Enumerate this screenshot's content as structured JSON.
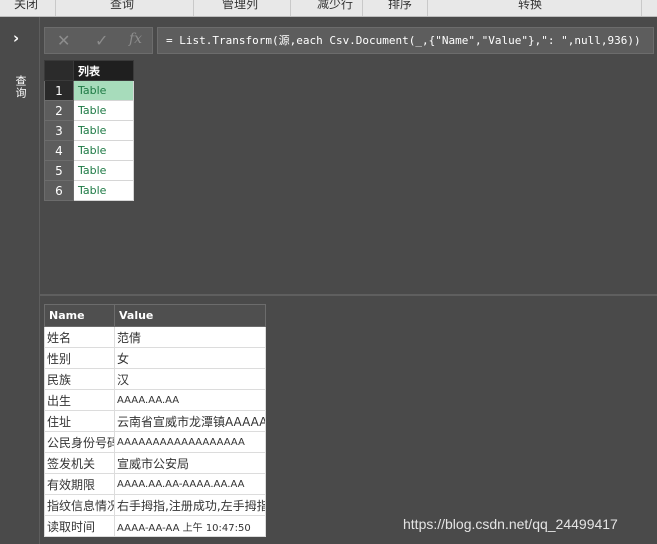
{
  "ribbon": {
    "groups": [
      "关闭",
      "查询",
      "管理列",
      "减少行",
      "排序",
      "转换"
    ]
  },
  "left_pane": {
    "chevron": "›",
    "label": "查询"
  },
  "formula_bar": {
    "cancel_icon": "✕",
    "commit_icon": "✓",
    "fx_icon": "fx",
    "expression": "= List.Transform(源,each Csv.Document(_,{\"Name\",\"Value\"},\": \",null,936))"
  },
  "list_table": {
    "header": "列表",
    "rows": [
      {
        "num": "1",
        "value": "Table"
      },
      {
        "num": "2",
        "value": "Table"
      },
      {
        "num": "3",
        "value": "Table"
      },
      {
        "num": "4",
        "value": "Table"
      },
      {
        "num": "5",
        "value": "Table"
      },
      {
        "num": "6",
        "value": "Table"
      }
    ],
    "selected_row": 1
  },
  "preview_table": {
    "columns": [
      "Name",
      "Value"
    ],
    "rows": [
      {
        "name": "姓名",
        "value": "范倩"
      },
      {
        "name": "性别",
        "value": "女"
      },
      {
        "name": "民族",
        "value": "汉"
      },
      {
        "name": "出生",
        "value": "AAAA.AA.AA"
      },
      {
        "name": "住址",
        "value": "云南省宣威市龙潭镇AAAAA/"
      },
      {
        "name": "公民身份号码",
        "value": "AAAAAAAAAAAAAAAAAA"
      },
      {
        "name": "签发机关",
        "value": "宣威市公安局"
      },
      {
        "name": "有效期限",
        "value": "AAAA.AA.AA-AAAA.AA.AA"
      },
      {
        "name": "指纹信息情况",
        "value": "右手拇指,注册成功,左手拇指"
      },
      {
        "name": "读取时间",
        "value": "AAAA-AA-AA 上午 10:47:50"
      }
    ]
  },
  "watermark": "https://blog.csdn.net/qq_24499417",
  "colors": {
    "background": "#4a4a4a",
    "selected_cell": "#a7dcbb",
    "table_link_text": "#1e7a45"
  }
}
